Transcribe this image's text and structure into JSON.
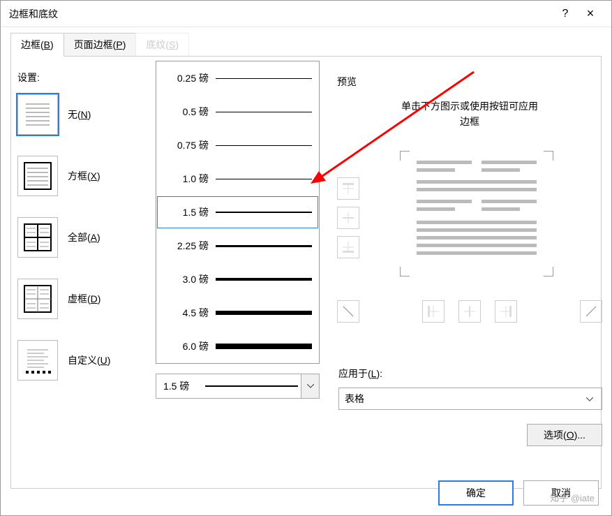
{
  "dialog": {
    "title": "边框和底纹",
    "help": "?",
    "close": "×"
  },
  "tabs": {
    "border": "边框(B)",
    "page_border": "页面边框(P)",
    "shading": "底纹(S)"
  },
  "settings": {
    "label": "设置:",
    "none": "无(N)",
    "box": "方框(X)",
    "all": "全部(A)",
    "grid": "虚框(D)",
    "custom": "自定义(U)"
  },
  "width_options": [
    {
      "label": "0.25 磅",
      "cls": "line-025"
    },
    {
      "label": "0.5 磅",
      "cls": "line-05"
    },
    {
      "label": "0.75 磅",
      "cls": "line-075"
    },
    {
      "label": "1.0 磅",
      "cls": "line-10"
    },
    {
      "label": "1.5 磅",
      "cls": "line-15",
      "selected": true
    },
    {
      "label": "2.25 磅",
      "cls": "line-225"
    },
    {
      "label": "3.0 磅",
      "cls": "line-30"
    },
    {
      "label": "4.5 磅",
      "cls": "line-45"
    },
    {
      "label": "6.0 磅",
      "cls": "line-60"
    }
  ],
  "current_width": {
    "label": "1.5 磅",
    "cls": "line-15"
  },
  "preview": {
    "title": "预览",
    "hint1": "单击下方图示或使用按钮可应用",
    "hint2": "边框"
  },
  "apply_to": {
    "label": "应用于(L):",
    "value": "表格"
  },
  "options_btn": "选项(O)...",
  "buttons": {
    "ok": "确定",
    "cancel": "取消"
  },
  "watermark": "知乎 @iate"
}
